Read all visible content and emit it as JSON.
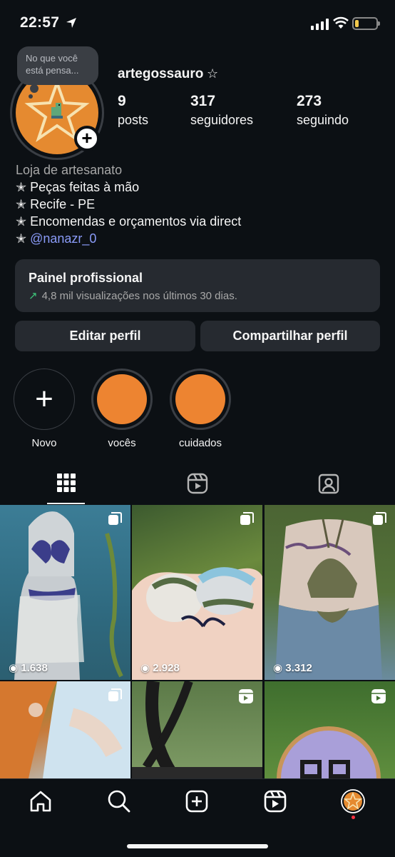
{
  "status_bar": {
    "time": "22:57"
  },
  "note": {
    "text": "No que você está pensa..."
  },
  "profile": {
    "username": "artegossauro",
    "username_suffix": "☆",
    "stats": [
      {
        "num": "9",
        "label": "posts"
      },
      {
        "num": "317",
        "label": "seguidores"
      },
      {
        "num": "273",
        "label": "seguindo"
      }
    ],
    "bio": {
      "category": "Loja de artesanato",
      "lines": [
        "Peças feitas à mão",
        "Recife - PE",
        "Encomendas e orçamentos via direct"
      ],
      "mention": "@nanazr_0",
      "bullet": "✭"
    }
  },
  "dashboard": {
    "title": "Painel profissional",
    "subtitle": "4,8 mil visualizações nos últimos 30 dias."
  },
  "buttons": {
    "edit": "Editar perfil",
    "share": "Compartilhar perfil"
  },
  "highlights": [
    {
      "label": "Novo"
    },
    {
      "label": "vocês"
    },
    {
      "label": "cuidados"
    }
  ],
  "grid": [
    {
      "views": "1.638"
    },
    {
      "views": "2.928"
    },
    {
      "views": "3.312"
    },
    {
      "views": ""
    },
    {
      "views": ""
    },
    {
      "views": ""
    }
  ],
  "colors": {
    "accent": "#ed8431",
    "mention": "#8a9bf8",
    "trend": "#3ec47a"
  }
}
